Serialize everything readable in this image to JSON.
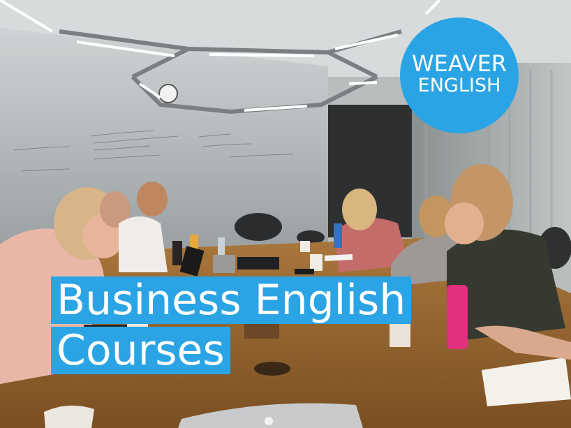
{
  "logo": {
    "line1": "WEAVER",
    "line2": "ENGLISH",
    "color": "#2aa4e4"
  },
  "headline": {
    "line1": "Business English",
    "line2": "Courses"
  }
}
